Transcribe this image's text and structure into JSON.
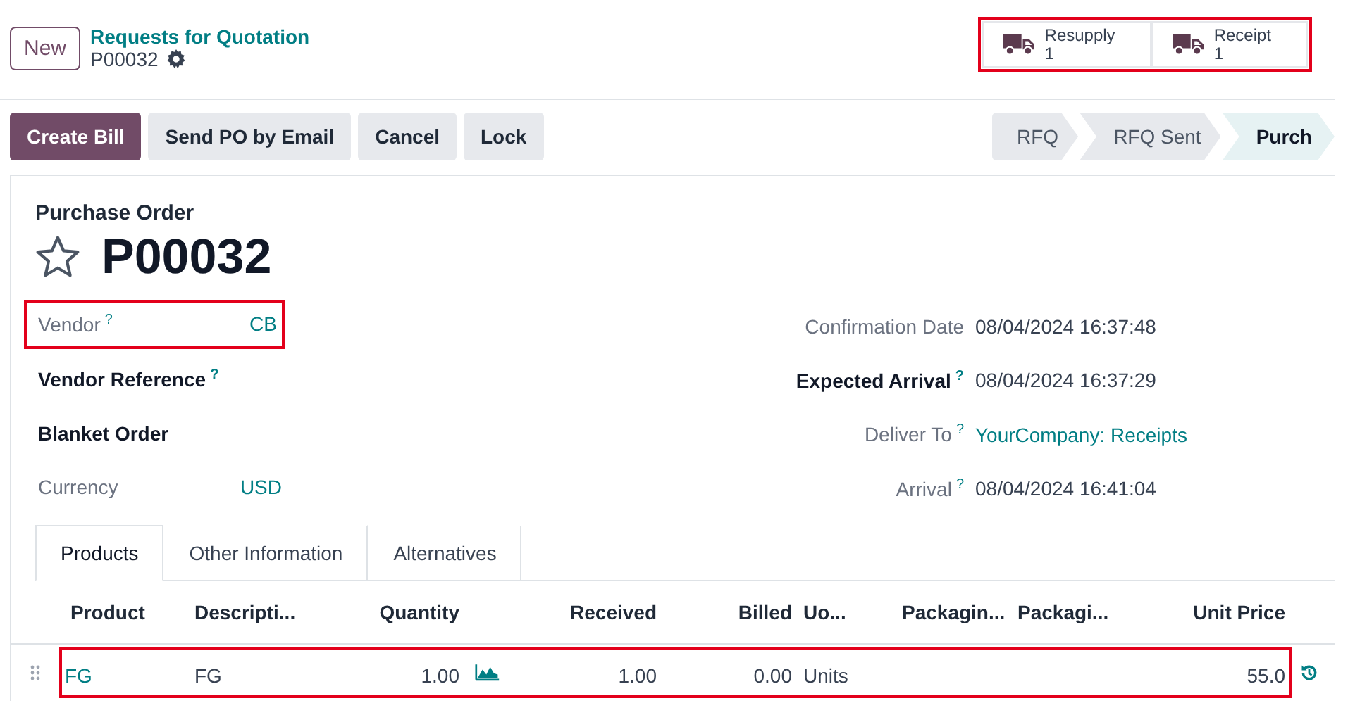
{
  "control_panel": {
    "new_button": "New",
    "breadcrumb": "Requests for Quotation",
    "record": "P00032"
  },
  "smart_buttons": {
    "highlighted": true,
    "items": [
      {
        "label": "Resupply",
        "value": "1"
      },
      {
        "label": "Receipt",
        "value": "1"
      }
    ]
  },
  "actions": [
    {
      "label": "Create Bill",
      "primary": true
    },
    {
      "label": "Send PO by Email",
      "primary": false
    },
    {
      "label": "Cancel",
      "primary": false
    },
    {
      "label": "Lock",
      "primary": false
    }
  ],
  "status_bar": [
    {
      "label": "RFQ",
      "selected": false
    },
    {
      "label": "RFQ Sent",
      "selected": false
    },
    {
      "label": "Purch",
      "selected": true
    }
  ],
  "form": {
    "subtitle": "Purchase Order",
    "title": "P00032",
    "starred": false,
    "left_fields": [
      {
        "label": "Vendor",
        "help": "?",
        "value": "CB",
        "bold": false,
        "link": true,
        "highlighted": true
      },
      {
        "label": "Vendor Reference",
        "help": "?",
        "bold": true,
        "highlighted": false
      },
      {
        "label": "Blanket Order",
        "bold": true,
        "highlighted": false
      },
      {
        "label": "Currency",
        "value": "USD",
        "bold": false,
        "link": true,
        "highlighted": false
      }
    ],
    "right_fields": [
      {
        "label": "Confirmation Date",
        "value": "08/04/2024 16:37:48",
        "bold": false,
        "link": false
      },
      {
        "label": "Expected Arrival",
        "help": "?",
        "value": "08/04/2024 16:37:29",
        "bold": true,
        "link": false
      },
      {
        "label": "Deliver To",
        "help": "?",
        "value": "YourCompany: Receipts",
        "bold": false,
        "link": true
      },
      {
        "label": "Arrival",
        "help": "?",
        "value": "08/04/2024 16:41:04",
        "bold": false,
        "link": false
      }
    ]
  },
  "tabs": [
    {
      "label": "Products",
      "selected": true
    },
    {
      "label": "Other Information",
      "selected": false
    },
    {
      "label": "Alternatives",
      "selected": false
    }
  ],
  "table": {
    "columns": [
      "Product",
      "Descripti...",
      "Quantity",
      "Received",
      "Billed",
      "Uo...",
      "Packagin...",
      "Packagi...",
      "Unit Price"
    ],
    "rows": [
      {
        "highlighted": true,
        "cells": [
          "FG",
          "FG",
          "1.00",
          "1.00",
          "0.00",
          "Units",
          "",
          "",
          "55.0"
        ]
      }
    ]
  }
}
